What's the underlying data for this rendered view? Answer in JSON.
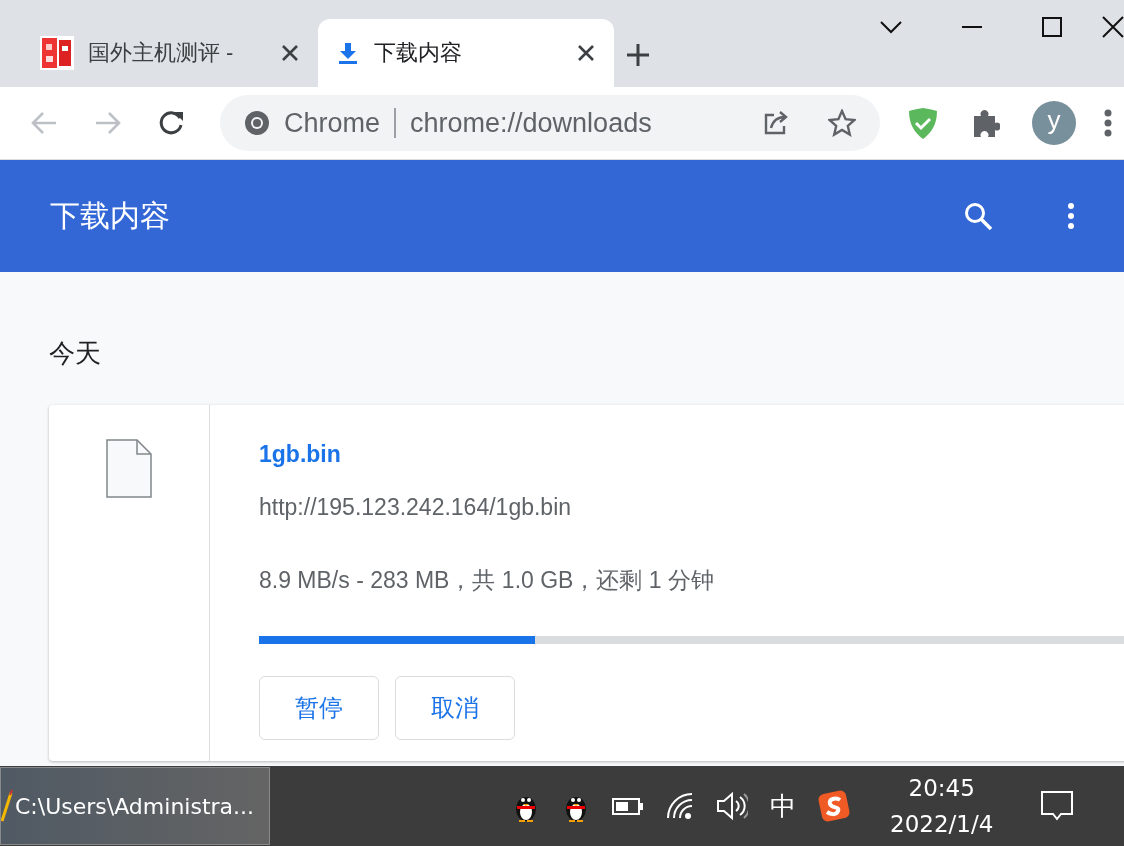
{
  "tabs": [
    {
      "title": "国外主机测评 -",
      "selected": false
    },
    {
      "title": "下载内容",
      "selected": true
    }
  ],
  "omnibox": {
    "site": "Chrome",
    "url": "chrome://downloads"
  },
  "avatar": {
    "letter": "y"
  },
  "header": {
    "title": "下载内容"
  },
  "sections": [
    {
      "date": "今天",
      "items": [
        {
          "name": "1gb.bin",
          "url": "http://195.123.242.164/1gb.bin",
          "status": "8.9 MB/s - 283 MB，共 1.0 GB，还剩 1 分钟",
          "level": 0.31,
          "buttons": [
            "暂停",
            "取消"
          ]
        }
      ]
    }
  ],
  "taskbar": {
    "window": "C:\\Users\\Administra...",
    "ime": "中",
    "time": "20:45",
    "date": "2022/1/4"
  }
}
